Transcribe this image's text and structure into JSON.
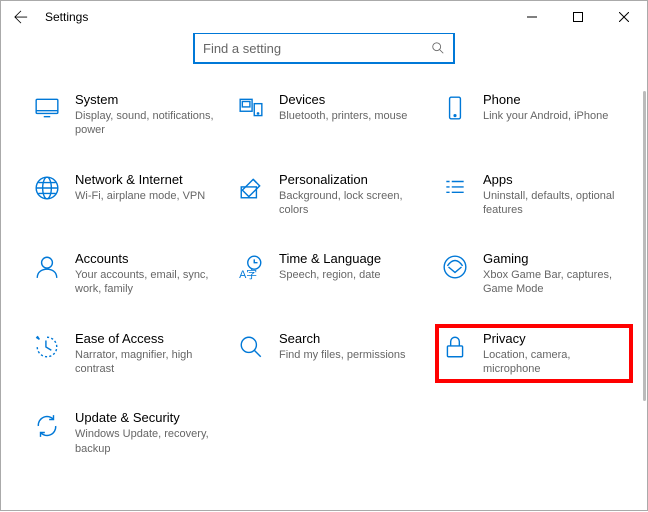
{
  "window": {
    "title": "Settings"
  },
  "search": {
    "placeholder": "Find a setting"
  },
  "tiles": {
    "system": {
      "title": "System",
      "sub": "Display, sound, notifications, power"
    },
    "devices": {
      "title": "Devices",
      "sub": "Bluetooth, printers, mouse"
    },
    "phone": {
      "title": "Phone",
      "sub": "Link your Android, iPhone"
    },
    "network": {
      "title": "Network & Internet",
      "sub": "Wi-Fi, airplane mode, VPN"
    },
    "personalization": {
      "title": "Personalization",
      "sub": "Background, lock screen, colors"
    },
    "apps": {
      "title": "Apps",
      "sub": "Uninstall, defaults, optional features"
    },
    "accounts": {
      "title": "Accounts",
      "sub": "Your accounts, email, sync, work, family"
    },
    "time": {
      "title": "Time & Language",
      "sub": "Speech, region, date"
    },
    "gaming": {
      "title": "Gaming",
      "sub": "Xbox Game Bar, captures, Game Mode"
    },
    "ease": {
      "title": "Ease of Access",
      "sub": "Narrator, magnifier, high contrast"
    },
    "search_tile": {
      "title": "Search",
      "sub": "Find my files, permissions"
    },
    "privacy": {
      "title": "Privacy",
      "sub": "Location, camera, microphone"
    },
    "update": {
      "title": "Update & Security",
      "sub": "Windows Update, recovery, backup"
    }
  }
}
